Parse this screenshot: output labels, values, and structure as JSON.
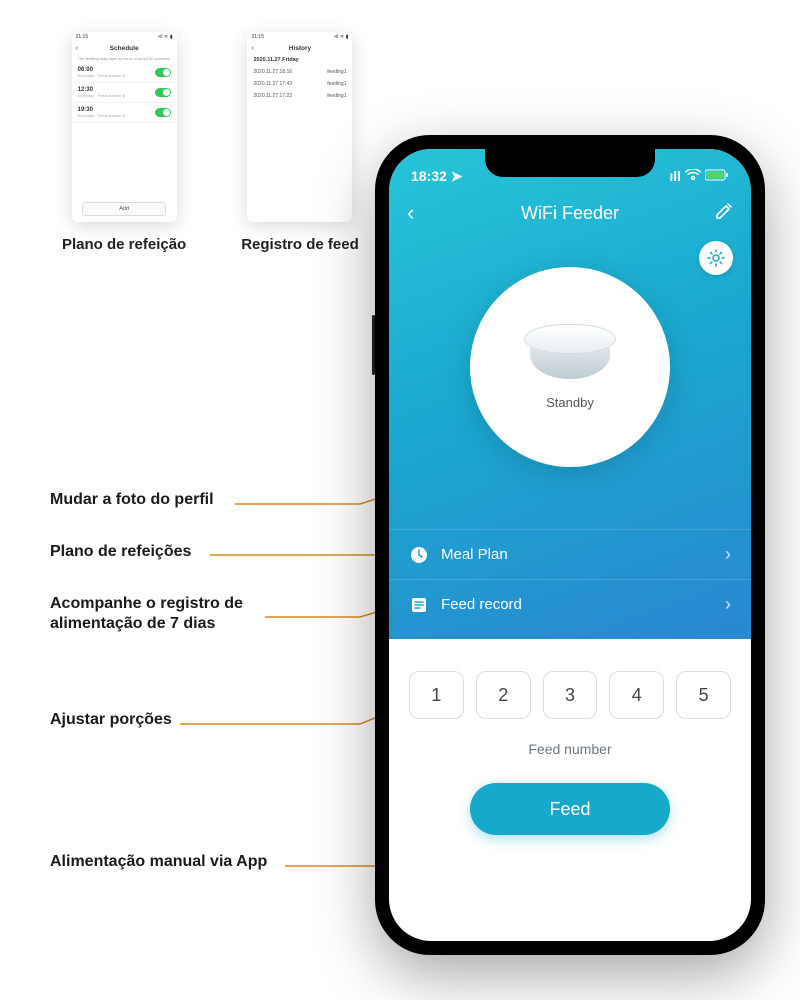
{
  "mini_schedule": {
    "statusbar_time": "21:15",
    "title": "Schedule",
    "note": "The feeding may have an error of about 30 seconds",
    "rows": [
      {
        "time": "06:00",
        "sub": "Everyday · Feed number 8"
      },
      {
        "time": "12:30",
        "sub": "Everyday · Feed number 8"
      },
      {
        "time": "19:30",
        "sub": "Everyday · Feed number 8"
      }
    ],
    "add_label": "Add",
    "caption": "Plano de refeição"
  },
  "mini_history": {
    "statusbar_time": "21:15",
    "title": "History",
    "date_header": "2020.11.27 Friday",
    "rows": [
      {
        "ts": "2020.11.27 18:16",
        "tag": "feeding1"
      },
      {
        "ts": "2020.11.27 17:43",
        "tag": "feeding1"
      },
      {
        "ts": "2020.11.27 17:22",
        "tag": "feeding1"
      }
    ],
    "caption": "Registro de feed"
  },
  "callouts": {
    "profile": "Mudar a foto do perfil",
    "meal_plan": "Plano de refeições",
    "feed_record": "Acompanhe o registro de\nalimentação de 7 dias",
    "portions": "Ajustar porções",
    "manual_feed": "Alimentação manual via App"
  },
  "main": {
    "statusbar_time": "18:32",
    "title": "WiFi Feeder",
    "status_text": "Standby",
    "menu_meal_plan": "Meal Plan",
    "menu_feed_record": "Feed record",
    "portions": [
      "1",
      "2",
      "3",
      "4",
      "5"
    ],
    "portion_label": "Feed number",
    "feed_button": "Feed"
  }
}
